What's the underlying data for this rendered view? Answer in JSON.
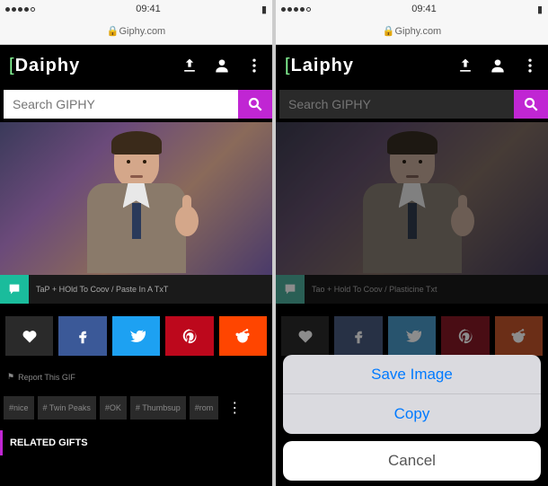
{
  "status": {
    "time": "09:41",
    "carrier": "•••••"
  },
  "browser": {
    "url": "Giphy.com"
  },
  "left": {
    "logo": "Daiphy",
    "search": {
      "placeholder": "Search GIPHY"
    },
    "caption": "TaP + HOld To Coov / Paste In A TxT",
    "share": {
      "fav": "favorite",
      "fb": "facebook",
      "tw": "twitter",
      "pn": "pinterest",
      "rd": "reddit"
    },
    "report": "Report This GIF",
    "tags": [
      "#nice",
      "# Twin Peaks",
      "#OK",
      "# Thumbsup",
      "#rom"
    ],
    "related": "RELATED GIFTS"
  },
  "right": {
    "logo": "Laiphy",
    "search": {
      "placeholder": "Search GIPHY"
    },
    "caption": "Tao + Hold To Coov / Plasticine Txt",
    "sheet": {
      "save": "Save Image",
      "copy": "Copy",
      "cancel": "Cancel"
    }
  },
  "colors": {
    "accent": "#c026d3",
    "msg": "#1abc9c",
    "fb": "#3b5998",
    "tw": "#1da1f2",
    "pn": "#bd081c",
    "rd": "#ff4500",
    "ios_blue": "#007aff"
  }
}
